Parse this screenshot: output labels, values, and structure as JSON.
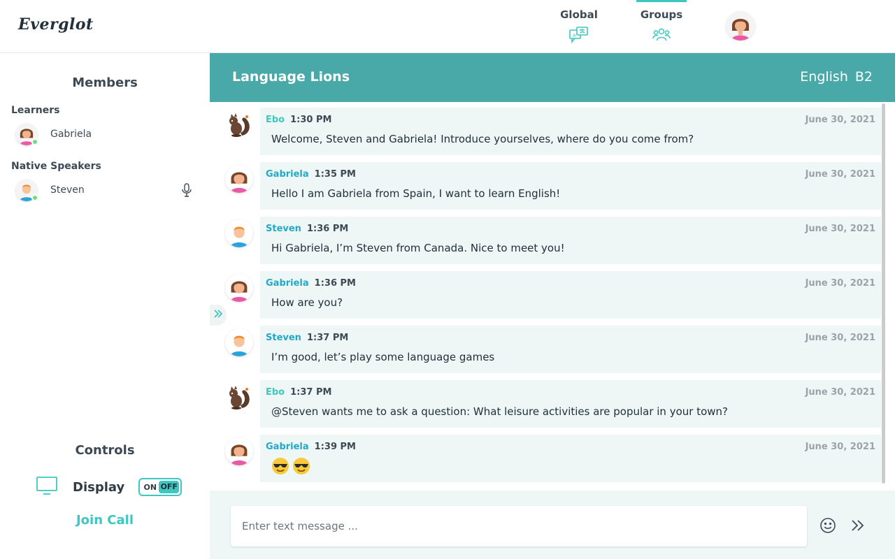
{
  "header": {
    "logo": "Everglot",
    "nav": [
      {
        "label": "Global",
        "icon": "translate-chat-icon"
      },
      {
        "label": "Groups",
        "icon": "group-people-icon",
        "active": true
      }
    ],
    "accent_color": "#3fc6c1"
  },
  "sidebar": {
    "members_title": "Members",
    "learners_label": "Learners",
    "native_label": "Native Speakers",
    "learners": [
      {
        "name": "Gabriela",
        "online": true
      }
    ],
    "native_speakers": [
      {
        "name": "Steven",
        "online": true,
        "mic": true
      }
    ],
    "controls_title": "Controls",
    "display_label": "Display",
    "toggle_on": "ON",
    "toggle_off": "OFF",
    "join_call": "Join Call"
  },
  "chat": {
    "title": "Language Lions",
    "language": "English",
    "level": "B2",
    "header_color": "#49a8a8",
    "messages": [
      {
        "author": "Ebo",
        "time": "1:30 PM",
        "date": "June 30, 2021",
        "text": "Welcome, Steven and Gabriela! Introduce yourselves, where do you come from?",
        "avatar": "squirrel"
      },
      {
        "author": "Gabriela",
        "time": "1:35 PM",
        "date": "June 30, 2021",
        "text": "Hello I am Gabriela from Spain, I want to learn English!",
        "avatar": "gabriela"
      },
      {
        "author": "Steven",
        "time": "1:36 PM",
        "date": "June 30, 2021",
        "text": "Hi Gabriela, I’m Steven from Canada. Nice to meet you!",
        "avatar": "steven"
      },
      {
        "author": "Gabriela",
        "time": "1:36 PM",
        "date": "June 30, 2021",
        "text": "How are you?",
        "avatar": "gabriela"
      },
      {
        "author": "Steven",
        "time": "1:37 PM",
        "date": "June 30, 2021",
        "text": "I’m good, let’s play some language games",
        "avatar": "steven"
      },
      {
        "author": "Ebo",
        "time": "1:37 PM",
        "date": "June 30, 2021",
        "text": "@Steven wants me to ask a question: What leisure activities are popular in your town?",
        "avatar": "squirrel"
      },
      {
        "author": "Gabriela",
        "time": "1:39 PM",
        "date": "June 30, 2021",
        "text": "",
        "avatar": "gabriela",
        "emojis": [
          "sunglasses-emoji",
          "sunglasses-emoji"
        ]
      }
    ]
  },
  "composer": {
    "placeholder": "Enter text message ..."
  }
}
